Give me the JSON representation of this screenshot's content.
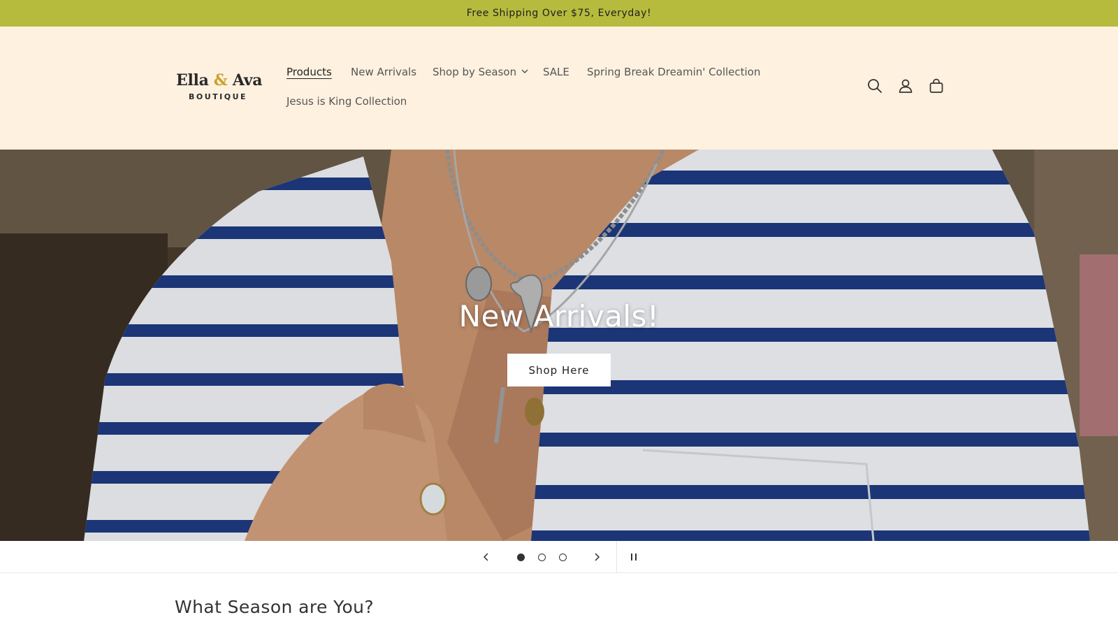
{
  "announcement": {
    "text": "Free Shipping Over $75, Everyday!"
  },
  "header": {
    "logo": {
      "main_part1": "Ella ",
      "ampersand": "&",
      "main_part2": " Ava",
      "sub": "BOUTIQUE"
    },
    "nav": {
      "products": "Products",
      "new_arrivals": "New Arrivals",
      "shop_by_season": "Shop by Season",
      "sale": "SALE",
      "spring_break": "Spring Break Dreamin' Collection",
      "jesus_is_king": "Jesus is King Collection"
    },
    "icons": [
      "search-icon",
      "account-icon",
      "cart-icon"
    ]
  },
  "hero": {
    "title": "New Arrivals!",
    "button_label": "Shop Here",
    "slide_count": 3,
    "active_slide": 1
  },
  "slideshow_controls": {
    "icons": [
      "chevron-left-icon",
      "chevron-right-icon",
      "pause-icon"
    ]
  },
  "section": {
    "title": "What Season are You?"
  },
  "colors": {
    "announcement_bg": "#b6bb3e",
    "header_bg": "#fff1e0",
    "logo_accent": "#c9a227",
    "stripe_navy": "#1e3a82"
  }
}
